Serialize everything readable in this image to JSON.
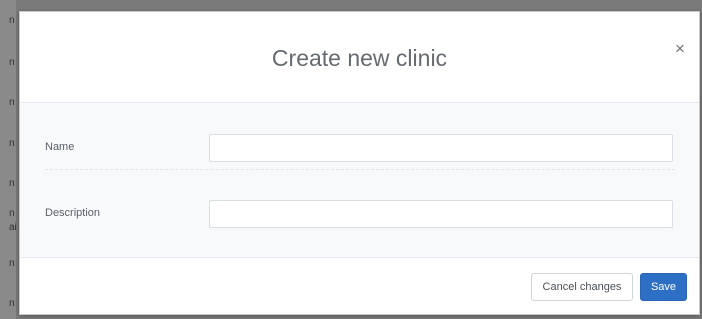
{
  "backdrop": {
    "glyphs": [
      "n",
      "n",
      "n",
      "n",
      "n",
      "n",
      "ai",
      "n",
      "n"
    ]
  },
  "modal": {
    "title": "Create new clinic",
    "close_label": "×",
    "fields": [
      {
        "label": "Name",
        "value": "",
        "placeholder": ""
      },
      {
        "label": "Description",
        "value": "",
        "placeholder": ""
      }
    ],
    "footer": {
      "cancel_label": "Cancel changes",
      "save_label": "Save"
    }
  },
  "colors": {
    "primary": "#2d6fc4",
    "body_background": "#f7f9fb"
  }
}
